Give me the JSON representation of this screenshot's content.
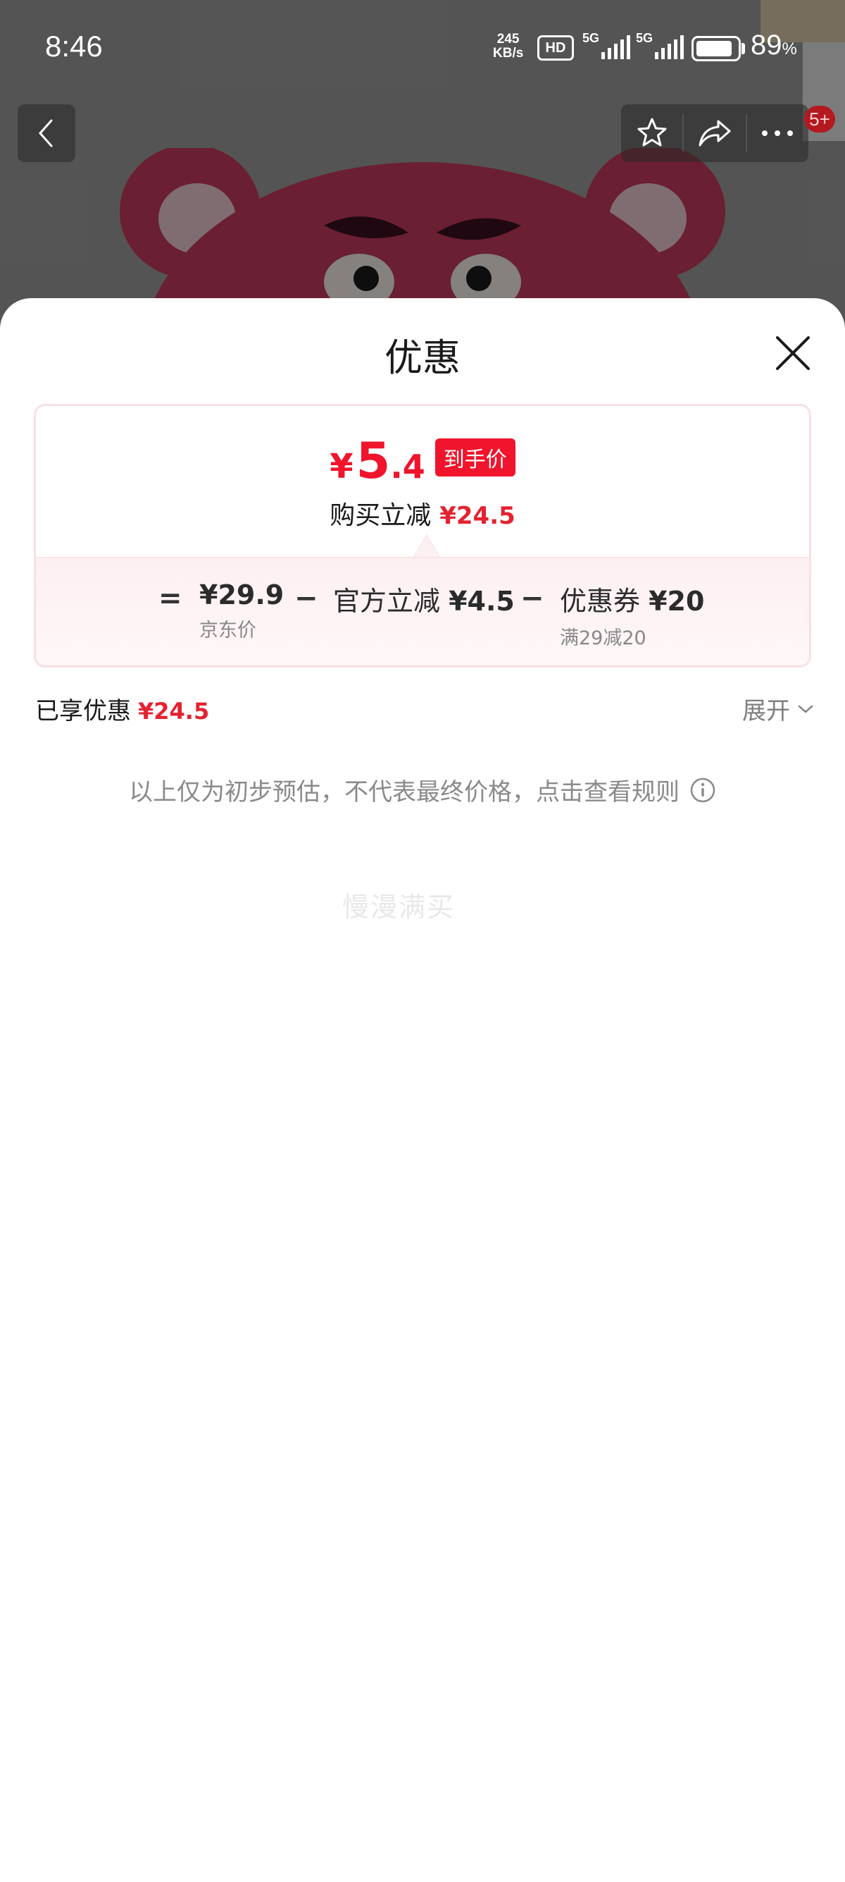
{
  "status_bar": {
    "time": "8:46",
    "net_speed_value": "245",
    "net_speed_unit": "KB/s",
    "hd_label": "HD",
    "signal_1_label": "5G",
    "signal_2_label": "5G",
    "battery_percent": "89",
    "battery_percent_unit": "%",
    "battery_level": 0.89
  },
  "nav": {
    "back_icon": "chevron-left-icon",
    "favorite_icon": "star-icon",
    "share_icon": "share-icon",
    "more_icon": "more-icon",
    "notification_badge": "5+"
  },
  "sheet": {
    "title": "优惠",
    "close_icon": "close-icon",
    "card": {
      "final_price_currency": "¥",
      "final_price_int": "5",
      "final_price_dec": ".4",
      "final_price_tag": "到手价",
      "save_label": "购买立减",
      "save_amount": "¥24.5",
      "formula": {
        "equals": "=",
        "minus": "−",
        "jd_price": "¥29.9",
        "jd_price_label": "京东价",
        "official_label": "官方立减",
        "official_amount": "¥4.5",
        "coupon_label": "优惠券",
        "coupon_amount": "¥20",
        "coupon_condition": "满29减20"
      }
    },
    "enjoyed_label": "已享优惠",
    "enjoyed_amount": "¥24.5",
    "expand_label": "展开",
    "disclaimer": "以上仅为初步预估，不代表最终价格，点击查看规则",
    "watermark": "慢漫满买"
  },
  "colors": {
    "accent_red": "#f0142c",
    "badge_red": "#b3191f",
    "card_border": "#f9dfe3",
    "bear_pink": "#c23a5c"
  }
}
